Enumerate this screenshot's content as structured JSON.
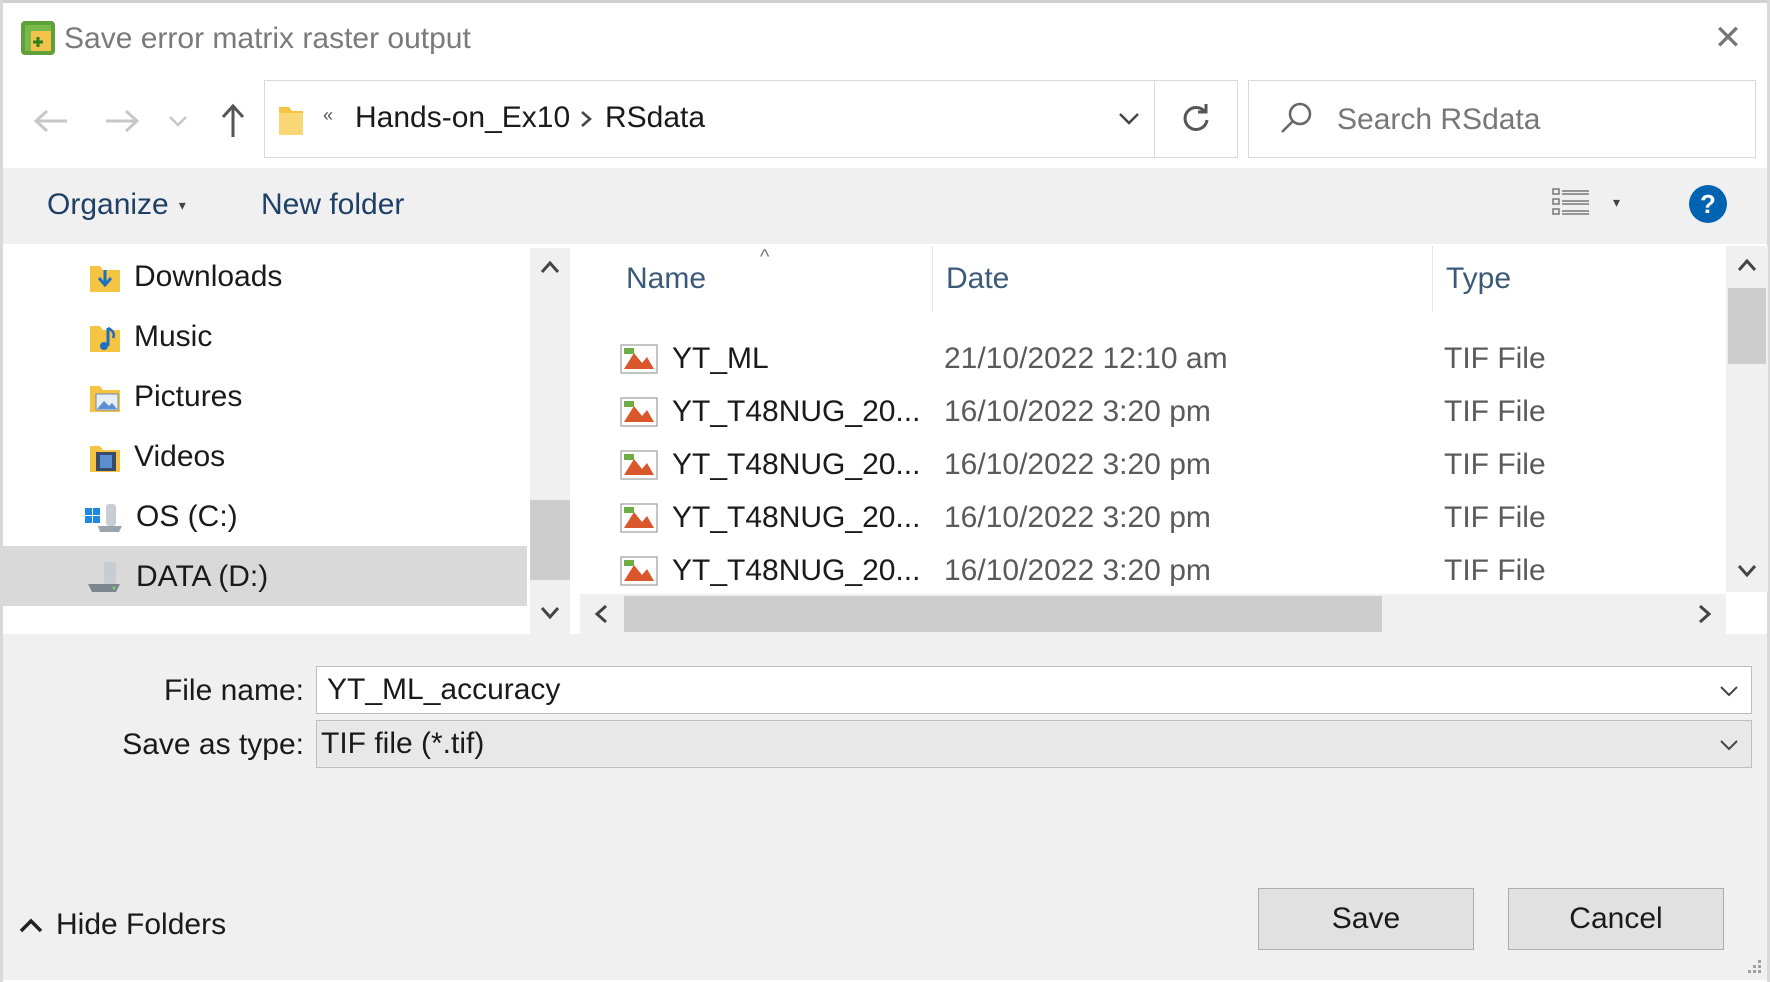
{
  "window": {
    "title": "Save error matrix raster output",
    "close_glyph": "✕"
  },
  "nav": {
    "back_glyph": "←",
    "forward_glyph": "→",
    "recent_glyph": "⌄",
    "up_glyph": "↑",
    "overflow_glyph": "«",
    "crumbs": [
      "Hands-on_Ex10",
      "RSdata"
    ],
    "crumb_sep": "›",
    "dropdown_glyph": "⌄",
    "refresh_glyph": "↻",
    "search_placeholder": "Search RSdata"
  },
  "toolbar": {
    "organize_label": "Organize",
    "organize_caret": "▾",
    "new_folder_label": "New folder",
    "view_caret": "▾",
    "help_label": "?"
  },
  "tree": {
    "items": [
      {
        "label": "Downloads",
        "icon": "downloads-folder-icon"
      },
      {
        "label": "Music",
        "icon": "music-folder-icon"
      },
      {
        "label": "Pictures",
        "icon": "pictures-folder-icon"
      },
      {
        "label": "Videos",
        "icon": "videos-folder-icon"
      },
      {
        "label": "OS (C:)",
        "icon": "os-drive-icon"
      },
      {
        "label": "DATA (D:)",
        "icon": "data-drive-icon"
      }
    ],
    "selected_index": 5
  },
  "list": {
    "columns": {
      "name": "Name",
      "date": "Date",
      "type": "Type"
    },
    "sort_glyph": "^",
    "rows": [
      {
        "name": "YT_ML",
        "date": "21/10/2022 12:10 am",
        "type": "TIF File"
      },
      {
        "name": "YT_T48NUG_20...",
        "date": "16/10/2022 3:20 pm",
        "type": "TIF File"
      },
      {
        "name": "YT_T48NUG_20...",
        "date": "16/10/2022 3:20 pm",
        "type": "TIF File"
      },
      {
        "name": "YT_T48NUG_20...",
        "date": "16/10/2022 3:20 pm",
        "type": "TIF File"
      },
      {
        "name": "YT_T48NUG_20...",
        "date": "16/10/2022 3:20 pm",
        "type": "TIF File"
      }
    ]
  },
  "form": {
    "file_name_label": "File name:",
    "file_name_value": "YT_ML_accuracy",
    "save_type_label": "Save as type:",
    "save_type_value": "TIF file (*.tif)",
    "dropdown_glyph": "⌄"
  },
  "footer": {
    "hide_folders_glyph": "^",
    "hide_folders_label": "Hide Folders",
    "save_label": "Save",
    "cancel_label": "Cancel"
  },
  "colors": {
    "accent": "#0063b1",
    "toolbar_bg": "#f0f0f0",
    "selection": "#d9d9d9"
  }
}
